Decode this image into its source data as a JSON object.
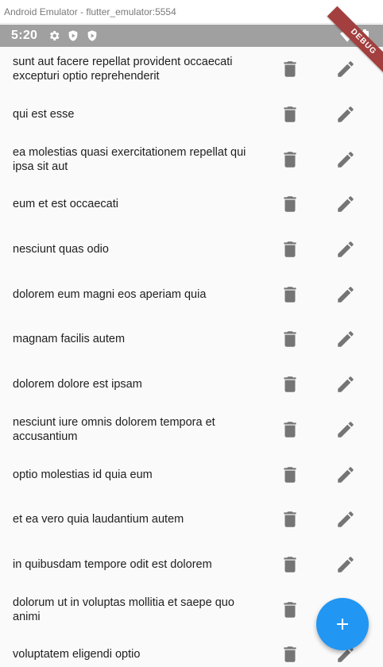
{
  "window": {
    "title": "Android Emulator - flutter_emulator:5554"
  },
  "status_bar": {
    "time": "5:20",
    "left_icons": [
      "gear-icon",
      "play-protect-icon",
      "play-protect-icon"
    ],
    "right_icons": [
      "wifi-icon",
      "battery-icon"
    ],
    "debug_banner": "DEBUG"
  },
  "posts": [
    {
      "title": "sunt aut facere repellat provident occaecati excepturi optio reprehenderit"
    },
    {
      "title": "qui est esse"
    },
    {
      "title": "ea molestias quasi exercitationem repellat qui ipsa sit aut"
    },
    {
      "title": "eum et est occaecati"
    },
    {
      "title": "nesciunt quas odio"
    },
    {
      "title": "dolorem eum magni eos aperiam quia"
    },
    {
      "title": "magnam facilis autem"
    },
    {
      "title": "dolorem dolore est ipsam"
    },
    {
      "title": "nesciunt iure omnis dolorem tempora et accusantium"
    },
    {
      "title": "optio molestias id quia eum"
    },
    {
      "title": "et ea vero quia laudantium autem"
    },
    {
      "title": "in quibusdam tempore odit est dolorem"
    },
    {
      "title": "dolorum ut in voluptas mollitia et saepe quo animi"
    },
    {
      "title": "voluptatem eligendi optio"
    }
  ],
  "row_icons": {
    "delete": "trash-icon",
    "edit": "pencil-icon"
  },
  "fab": {
    "icon": "plus-icon",
    "color": "#2196f3"
  },
  "colors": {
    "icon": "#757575",
    "status_bar": "#a0a0a0",
    "debug": "#a33f3f"
  }
}
